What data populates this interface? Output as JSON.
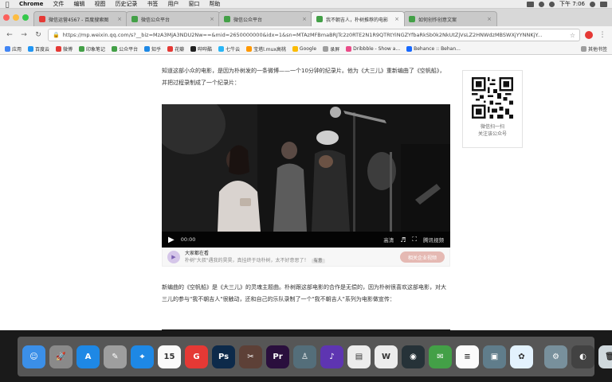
{
  "menubar": {
    "app": "Chrome",
    "items": [
      "文件",
      "编辑",
      "视图",
      "历史记录",
      "书签",
      "用户",
      "窗口",
      "帮助"
    ],
    "clock": "下午 7:06"
  },
  "tabs": [
    {
      "label": "微信运营4567 - 百度搜索图",
      "icon_color": "#e53935",
      "active": false
    },
    {
      "label": "微信公众平台",
      "icon_color": "#43a047",
      "active": false
    },
    {
      "label": "微信公众平台",
      "icon_color": "#43a047",
      "active": false
    },
    {
      "label": "我不朝吉人，朴树推荐的电影",
      "icon_color": "#43a047",
      "active": true
    },
    {
      "label": "如何创作创意文案",
      "icon_color": "#43a047",
      "active": false
    }
  ],
  "toolbar": {
    "url": "https://mp.weixin.qq.com/s?__biz=MzA3MjA3NDU2Nw==&mid=2650000000&idx=1&sn=MTAzMFBmaBRJTc2z0RTE2N1R9QTRtYiNGZYfbaRkSb0k2NkUtZjVsLZ2HNWdzMBSWXjYYNNKjY..."
  },
  "bookmarks": [
    {
      "label": "应用",
      "color": "#4285f4"
    },
    {
      "label": "百度云",
      "color": "#2196f3"
    },
    {
      "label": "微博",
      "color": "#e53935"
    },
    {
      "label": "印象笔记",
      "color": "#43a047"
    },
    {
      "label": "公众平台",
      "color": "#43a047"
    },
    {
      "label": "知乎",
      "color": "#1e88e5"
    },
    {
      "label": "花瓣",
      "color": "#e53935"
    },
    {
      "label": "哔哔酷",
      "color": "#212121"
    },
    {
      "label": "七牛云",
      "color": "#29b6f6"
    },
    {
      "label": "宝塔l.mux高桃",
      "color": "#ff9800"
    },
    {
      "label": "Google",
      "color": "#fbbc05"
    },
    {
      "label": "录屏",
      "color": "#9e9e9e"
    },
    {
      "label": "Dribbble - Show a...",
      "color": "#ea4c89"
    },
    {
      "label": "Behance :: Behan...",
      "color": "#1769ff"
    }
  ],
  "bookmarks_other": "其他书签",
  "article": {
    "para1": "知道这部小众的电影，是因为朴树发的一条微博——一个10分钟的纪录片。他为《大三儿》重新编曲了《空帆船》，并把过程录制成了一个纪录片：",
    "para2": "新编曲的《空帆船》是《大三儿》的灵魂主题曲。朴树跟这部电影的合作是无偿的，因为朴树很喜欢这部电影，对大三儿的参与\"我不朝吉人\"很触动，还和自己的乐队录制了一个\"我不朝吉人\"系列为电影做宣传："
  },
  "video": {
    "time": "00:00",
    "hd_label": "高清",
    "brand": "腾讯视频"
  },
  "related": {
    "title": "大家都在看",
    "desc": "朴树\"大叔\"遇我的昊昊，真挂终于动朴树，太不好意思了！",
    "chip": "有意",
    "button": "相关企业视频"
  },
  "qr": {
    "line1": "微信扫一扫",
    "line2": "关注该公众号"
  },
  "dock": [
    {
      "name": "finder",
      "glyph": "☺",
      "color": "#3b8fe8"
    },
    {
      "name": "launchpad",
      "glyph": "🚀",
      "color": "#8a8a8a"
    },
    {
      "name": "app-store",
      "glyph": "A",
      "color": "#1e88e5"
    },
    {
      "name": "preview",
      "glyph": "✎",
      "color": "#9e9e9e"
    },
    {
      "name": "safari",
      "glyph": "⌖",
      "color": "#1e88e5"
    },
    {
      "name": "calendar",
      "glyph": "15",
      "color": "#fafafa"
    },
    {
      "name": "script",
      "glyph": "G",
      "color": "#e53935"
    },
    {
      "name": "photoshop",
      "glyph": "Ps",
      "color": "#0d2a4a"
    },
    {
      "name": "tool",
      "glyph": "✂",
      "color": "#5d4037"
    },
    {
      "name": "premiere",
      "glyph": "Pr",
      "color": "#2a0f3d"
    },
    {
      "name": "keynote",
      "glyph": "♙",
      "color": "#546e7a"
    },
    {
      "name": "music",
      "glyph": "♪",
      "color": "#5e35b1"
    },
    {
      "name": "terminal",
      "glyph": "▤",
      "color": "#ececec"
    },
    {
      "name": "writer",
      "glyph": "W",
      "color": "#ececec"
    },
    {
      "name": "qq",
      "glyph": "◉",
      "color": "#263238"
    },
    {
      "name": "wechat",
      "glyph": "✉",
      "color": "#43a047"
    },
    {
      "name": "notes",
      "glyph": "≡",
      "color": "#fbfbfb"
    },
    {
      "name": "screen-tool",
      "glyph": "▣",
      "color": "#607d8b"
    },
    {
      "name": "photos",
      "glyph": "✿",
      "color": "#e3f2fd"
    },
    {
      "name": "system-prefs",
      "glyph": "⚙",
      "color": "#78909c"
    },
    {
      "name": "browser",
      "glyph": "◐",
      "color": "#424242"
    },
    {
      "name": "trash",
      "glyph": "🗑",
      "color": "#cfd8dc"
    }
  ]
}
